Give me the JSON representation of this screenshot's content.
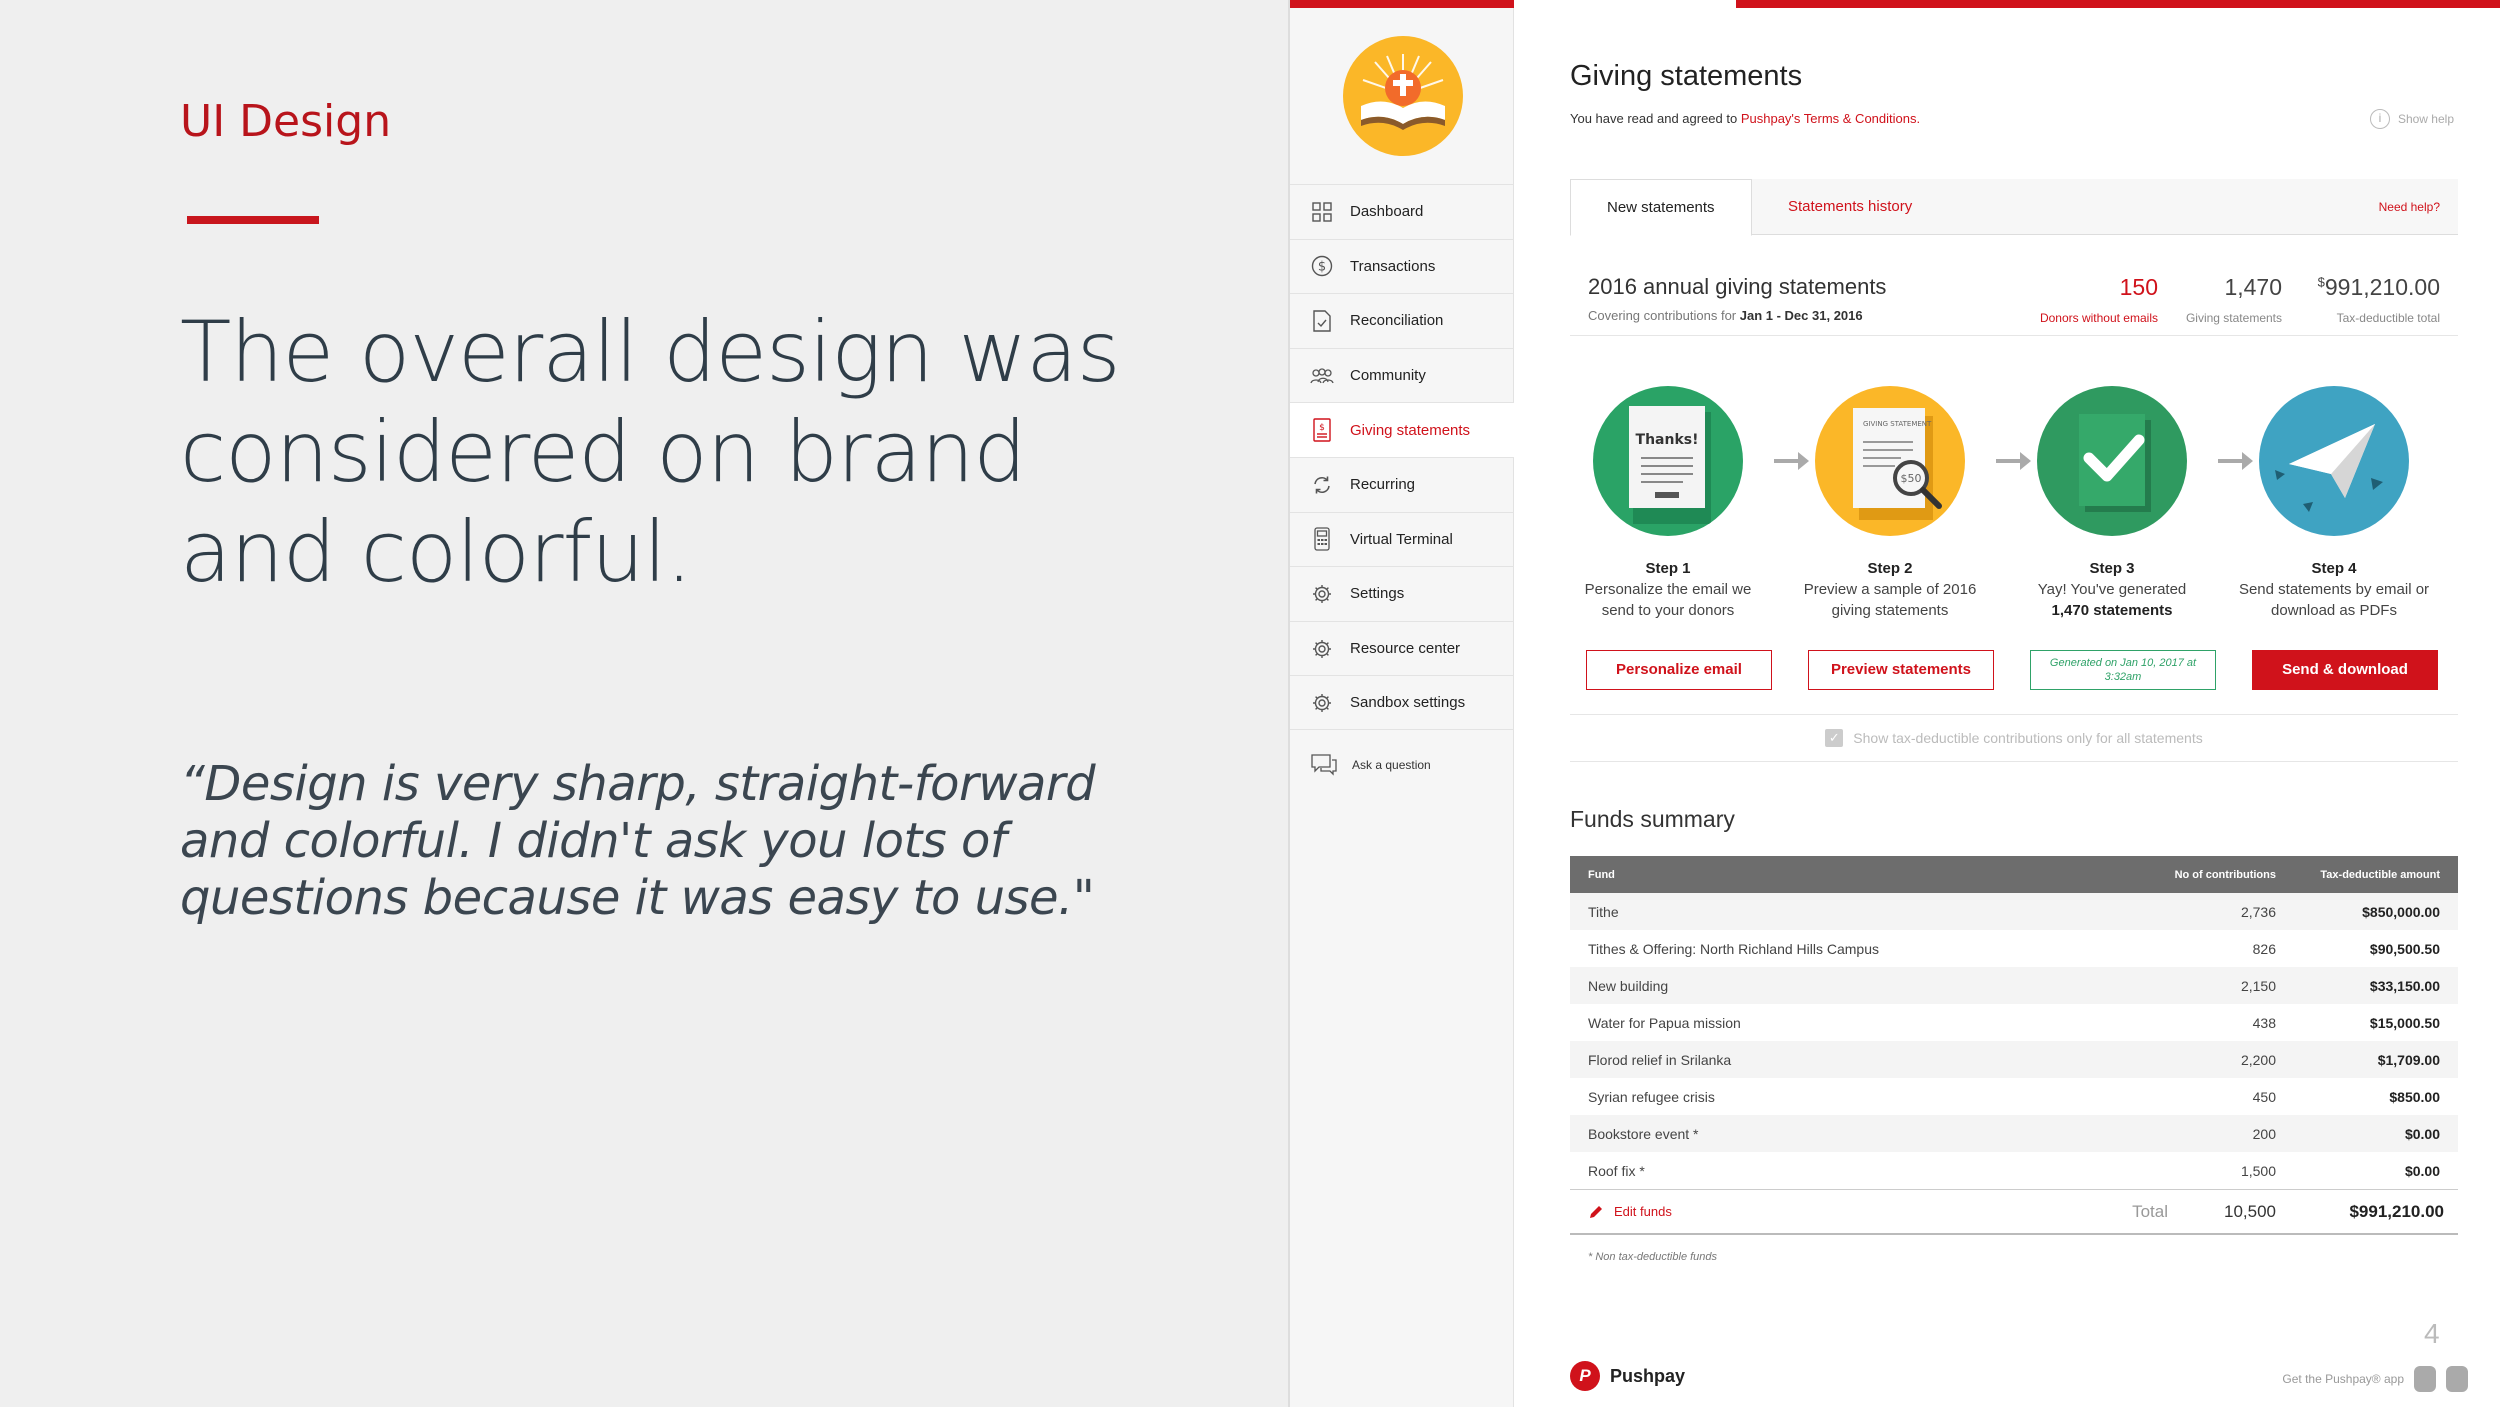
{
  "slide": {
    "section_label": "UI Design",
    "headline": "The overall design was considered on brand and colorful.",
    "quote": "“Design is very sharp, straight-forward and colorful. I didn't ask you lots of questions because it was easy to use.\"",
    "page_number": "4"
  },
  "sidebar": {
    "items": [
      {
        "label": "Dashboard",
        "icon": "grid-icon"
      },
      {
        "label": "Transactions",
        "icon": "dollar-icon"
      },
      {
        "label": "Reconciliation",
        "icon": "document-check-icon"
      },
      {
        "label": "Community",
        "icon": "people-icon"
      },
      {
        "label": "Giving statements",
        "icon": "statement-icon"
      },
      {
        "label": "Recurring",
        "icon": "refresh-icon"
      },
      {
        "label": "Virtual Terminal",
        "icon": "terminal-icon"
      },
      {
        "label": "Settings",
        "icon": "gear-icon"
      },
      {
        "label": "Resource center",
        "icon": "gear-icon"
      },
      {
        "label": "Sandbox settings",
        "icon": "gear-icon"
      }
    ],
    "ask": "Ask a question"
  },
  "header": {
    "title": "Giving statements",
    "agree_prefix": "You have read and agreed to ",
    "agree_link": "Pushpay's Terms & Conditions.",
    "show_help": "Show help"
  },
  "tabs": {
    "new": "New statements",
    "history": "Statements history",
    "need_help": "Need help?"
  },
  "summary": {
    "title": "2016 annual giving statements",
    "covering_prefix": "Covering contributions for ",
    "covering_range": "Jan 1 - Dec 31, 2016",
    "donors_without_emails_value": "150",
    "donors_without_emails_label": "Donors without emails",
    "giving_statements_value": "1,470",
    "giving_statements_label": "Giving statements",
    "tax_total_currency": "$",
    "tax_total_value": "991,210.00",
    "tax_total_label": "Tax-deductible total"
  },
  "steps": [
    {
      "step": "Step 1",
      "desc": "Personalize the email we send to your donors",
      "button": "Personalize email",
      "card_text": "Thanks!"
    },
    {
      "step": "Step 2",
      "desc": "Preview a sample of 2016 giving statements",
      "button": "Preview statements",
      "card_text": "GIVING STATEMENT",
      "amount": "$50"
    },
    {
      "step": "Step 3",
      "desc": "Yay! You've generated",
      "desc_bold": "1,470 statements",
      "button": "Generated on Jan 10, 2017 at 3:32am"
    },
    {
      "step": "Step 4",
      "desc": "Send statements by email or download as PDFs",
      "button": "Send & download"
    }
  ],
  "checkbox_label": "Show tax-deductible contributions only for all statements",
  "funds": {
    "title": "Funds summary",
    "columns": [
      "Fund",
      "No of contributions",
      "Tax-deductible amount"
    ],
    "rows": [
      {
        "fund": "Tithe",
        "count": "2,736",
        "amount": "$850,000.00"
      },
      {
        "fund": "Tithes & Offering: North Richland Hills Campus",
        "count": "826",
        "amount": "$90,500.50"
      },
      {
        "fund": "New building",
        "count": "2,150",
        "amount": "$33,150.00"
      },
      {
        "fund": "Water for Papua mission",
        "count": "438",
        "amount": "$15,000.50"
      },
      {
        "fund": "Florod relief in Srilanka",
        "count": "2,200",
        "amount": "$1,709.00"
      },
      {
        "fund": "Syrian refugee crisis",
        "count": "450",
        "amount": "$850.00"
      },
      {
        "fund": "Bookstore event *",
        "count": "200",
        "amount": "$0.00"
      },
      {
        "fund": "Roof fix *",
        "count": "1,500",
        "amount": "$0.00"
      }
    ],
    "edit_label": "Edit funds",
    "total_label": "Total",
    "total_count": "10,500",
    "total_amount": "$991,210.00",
    "footnote": "* Non tax-deductible funds"
  },
  "footer": {
    "brand": "Pushpay",
    "brand_mark": "P",
    "get_app": "Get the Pushpay® app"
  },
  "colors": {
    "accent": "#d0121b",
    "step1": "#2aa366",
    "step2": "#fbb728",
    "step3": "#2f9a60",
    "step4": "#3fa3c2"
  }
}
